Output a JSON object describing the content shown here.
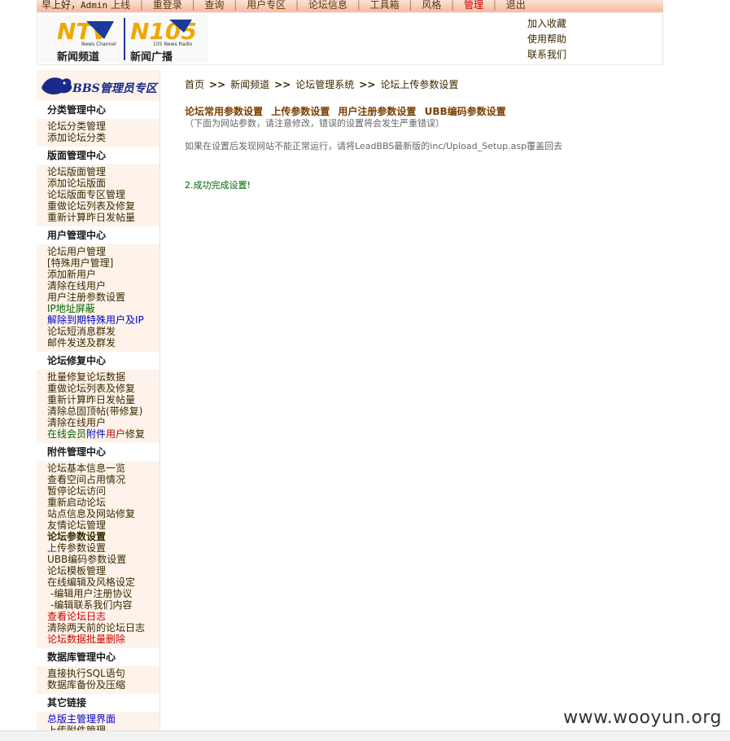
{
  "topnav": {
    "greeting": "早上好，",
    "user": "Admin",
    "items": [
      "上线",
      "重登录",
      "查询",
      "用户专区",
      "论坛信息",
      "工具箱",
      "风格",
      "管理",
      "退出"
    ],
    "active_item": "管理"
  },
  "header": {
    "logos": {
      "ntv_en": "News Channel",
      "ntv_cn": "新闻频道",
      "n105_en": "105 News Radio",
      "n105_cn": "新闻广播"
    },
    "links": [
      "加入收藏",
      "使用帮助",
      "联系我们"
    ]
  },
  "sidebar": {
    "logo_text": "BBS管理员专区",
    "sections": [
      {
        "title": "分类管理中心",
        "links": [
          "论坛分类管理",
          "添加论坛分类"
        ]
      },
      {
        "title": "版面管理中心",
        "links": [
          "论坛版面管理",
          "添加论坛版面",
          "论坛版面专区管理",
          "重做论坛列表及修复",
          "重新计算昨日发帖量"
        ]
      },
      {
        "title": "用户管理中心",
        "links": [
          "论坛用户管理",
          "[特殊用户管理]",
          "添加新用户",
          "清除在线用户",
          "用户注册参数设置",
          "IP地址屏蔽",
          "解除到期特殊用户及IP",
          "论坛短消息群发",
          "邮件发送及群发"
        ]
      },
      {
        "title": "论坛修复中心",
        "links": [
          "批量修复论坛数据",
          "重做论坛列表及修复",
          "重新计算昨日发帖量",
          "清除总固顶帖(带修复)",
          "清除在线用户",
          "在线会员附件用户修复"
        ]
      },
      {
        "title": "附件管理中心",
        "links": [
          "论坛基本信息一览",
          "查看空间占用情况",
          "暂停论坛访问",
          "重新启动论坛",
          "站点信息及网站修复",
          "友情论坛管理",
          "论坛参数设置",
          "上传参数设置",
          "UBB编码参数设置",
          "论坛模板管理",
          "在线编辑及风格设定",
          "-编辑用户注册协议",
          "-编辑联系我们内容",
          "查看论坛日志",
          "清除两天前的论坛日志",
          "论坛数据批量删除"
        ]
      },
      {
        "title": "数据库管理中心",
        "links": [
          "直接执行SQL语句",
          "数据库备份及压缩"
        ]
      },
      {
        "title": "其它链接",
        "links": [
          "总版主管理界面",
          "上传附件管理"
        ]
      }
    ],
    "mixed_link_parts": [
      "在线会员",
      "附件",
      "用户",
      "修复"
    ]
  },
  "content": {
    "breadcrumb": [
      "首页",
      "新闻频道",
      "论坛管理系统",
      "论坛上传参数设置"
    ],
    "tabs": [
      "论坛常用参数设置",
      "上传参数设置",
      "用户注册参数设置",
      "UBB编码参数设置"
    ],
    "note": "（下面为网站参数，请注意修改，错误的设置将会发生严重错误）",
    "note2": "如果在设置后发现网站不能正常运行，请将LeadBBS最新版的inc/Upload_Setup.asp覆盖回去",
    "success": "2.成功完成设置!"
  },
  "watermark": "www.wooyun.org",
  "colors": {
    "accent_red": "#cc0000",
    "link_green": "#006400",
    "link_blue": "#0000cc",
    "tab_brown": "#7a3e00"
  }
}
